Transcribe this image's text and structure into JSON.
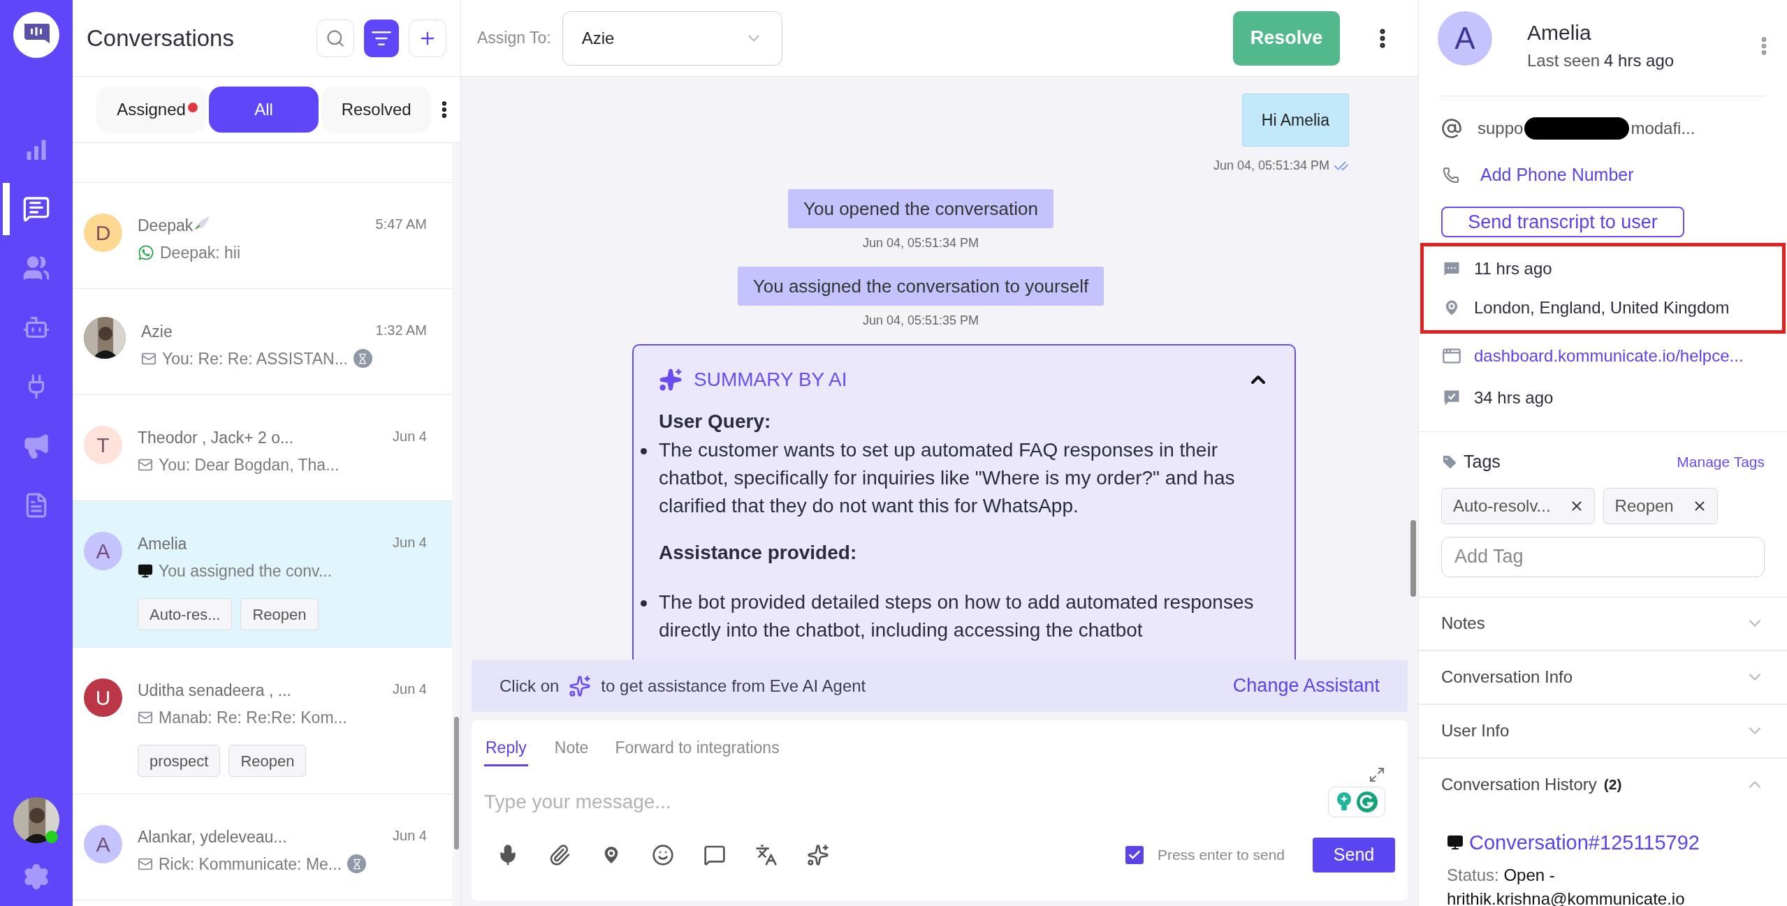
{
  "nav": {
    "items": [
      {
        "kind": "analytics",
        "selected": false
      },
      {
        "kind": "conversations",
        "selected": true
      },
      {
        "kind": "users",
        "selected": false
      },
      {
        "kind": "bot",
        "selected": false
      },
      {
        "kind": "integrations",
        "selected": false
      },
      {
        "kind": "campaigns",
        "selected": false
      },
      {
        "kind": "docs",
        "selected": false
      }
    ],
    "user": {
      "online": true
    }
  },
  "conversations": {
    "title": "Conversations",
    "filter_active": true,
    "filters": [
      {
        "label": "Assigned",
        "selected": false,
        "unread": true
      },
      {
        "label": "All",
        "selected": true,
        "unread": false
      },
      {
        "label": "Resolved",
        "selected": false,
        "unread": false
      }
    ],
    "items": [
      {
        "name": "Deepak",
        "emoji": true,
        "avatar": {
          "kind": "letter",
          "letter": "D",
          "color": "#fdd891"
        },
        "time": "5:47 AM",
        "channel": {
          "kind": "whatsapp"
        },
        "preview": "Deepak: hii",
        "pending": false,
        "selected": false
      },
      {
        "name": "Azie",
        "emoji": false,
        "time": "1:32 AM",
        "channel": {
          "kind": "email"
        },
        "preview": "You: Re: Re: ASSISTAN...",
        "pending": true,
        "selected": false
      },
      {
        "name": "Theodor , Jack+ 2 o...",
        "emoji": false,
        "avatar": {
          "kind": "letter",
          "letter": "T",
          "color": "#fde3d9"
        },
        "time": "Jun 4",
        "channel": {
          "kind": "email"
        },
        "preview": "You: Dear Bogdan, Tha...",
        "pending": false,
        "selected": false
      },
      {
        "name": "Amelia",
        "emoji": false,
        "avatar": {
          "kind": "letter",
          "letter": "A",
          "color": "#c5c3fd"
        },
        "time": "Jun 4",
        "channel": {
          "kind": "web"
        },
        "preview": "You assigned the conv...",
        "pending": false,
        "selected": true,
        "tags": [
          "Auto-res...",
          "Reopen"
        ]
      },
      {
        "name": "Uditha senadeera , ...",
        "emoji": false,
        "avatar": {
          "kind": "letter",
          "letter": "U",
          "color": "#bb3647"
        },
        "time": "Jun 4",
        "channel": {
          "kind": "email"
        },
        "preview": "Manab: Re: Re:Re: Kom...",
        "pending": false,
        "selected": false,
        "tags": [
          "prospect",
          "Reopen"
        ]
      },
      {
        "name": "Alankar, ydeleveau...",
        "emoji": false,
        "avatar": {
          "kind": "letter",
          "letter": "A",
          "color": "#c5c3fd"
        },
        "time": "Jun 4",
        "channel": {
          "kind": "email"
        },
        "preview": "Rick: Kommunicate: Me...",
        "pending": true,
        "selected": false
      }
    ]
  },
  "chat": {
    "assign": {
      "label": "Assign To:",
      "value": "Azie"
    },
    "resolve": "Resolve",
    "messages": [
      {
        "kind": "outgoing",
        "text": "Hi Amelia",
        "time": "Jun 04, 05:51:34 PM",
        "read": true
      },
      {
        "kind": "system",
        "text": "You opened the conversation",
        "time": "Jun 04, 05:51:34 PM"
      },
      {
        "kind": "system",
        "text": "You assigned the conversation to yourself",
        "time": "Jun 04, 05:51:35 PM"
      }
    ],
    "summary": {
      "title": "SUMMARY BY AI",
      "expanded": true,
      "sections": [
        {
          "heading": "User Query:",
          "bullets": [
            "The customer wants to set up automated FAQ responses in their chatbot, specifically for inquiries like \"Where is my order?\" and has clarified that they do not want this for WhatsApp."
          ]
        },
        {
          "heading": "Assistance provided:",
          "bullets": [
            "The bot provided detailed steps on how to add automated responses directly into the chatbot, including accessing the chatbot"
          ]
        }
      ]
    },
    "assistant_bar": {
      "before": "Click on",
      "after": "to get assistance from Eve AI Agent",
      "link": "Change Assistant"
    },
    "composer": {
      "tabs": [
        {
          "label": "Reply",
          "selected": true
        },
        {
          "label": "Note",
          "selected": false
        },
        {
          "label": "Forward to integrations",
          "selected": false
        }
      ],
      "placeholder": "Type your message...",
      "press_enter": {
        "label": "Press enter to send",
        "checked": true
      },
      "send": "Send"
    }
  },
  "contact": {
    "letter": "A",
    "name": "Amelia",
    "last_seen_label": "Last seen",
    "last_seen": "4 hrs ago",
    "email_start": "suppo",
    "email_end": "modafi...",
    "phone_link": "Add Phone Number",
    "transcript_button": "Send transcript to user",
    "highlighted": true,
    "details": [
      {
        "kind": "last-message",
        "text": "11 hrs ago",
        "highlight": true
      },
      {
        "kind": "location",
        "text": "London, England, United Kingdom",
        "highlight": true
      },
      {
        "kind": "page",
        "text": "dashboard.kommunicate.io/helpce...",
        "highlight": false
      },
      {
        "kind": "created",
        "text": "34 hrs ago",
        "highlight": false
      }
    ],
    "tags": {
      "title": "Tags",
      "manage": "Manage Tags",
      "items": [
        "Auto-resolv...",
        "Reopen"
      ],
      "placeholder": "Add Tag"
    },
    "sections": [
      {
        "title": "Notes",
        "expanded": false
      },
      {
        "title": "Conversation Info",
        "expanded": false
      },
      {
        "title": "User Info",
        "expanded": false
      },
      {
        "title": "Conversation History",
        "count": "(2)",
        "expanded": true
      }
    ],
    "history": [
      {
        "link": "Conversation#125115792",
        "status_label": "Status:",
        "status": "Open -",
        "assignee": "hrithik.krishna@kommunicate.io"
      }
    ]
  }
}
